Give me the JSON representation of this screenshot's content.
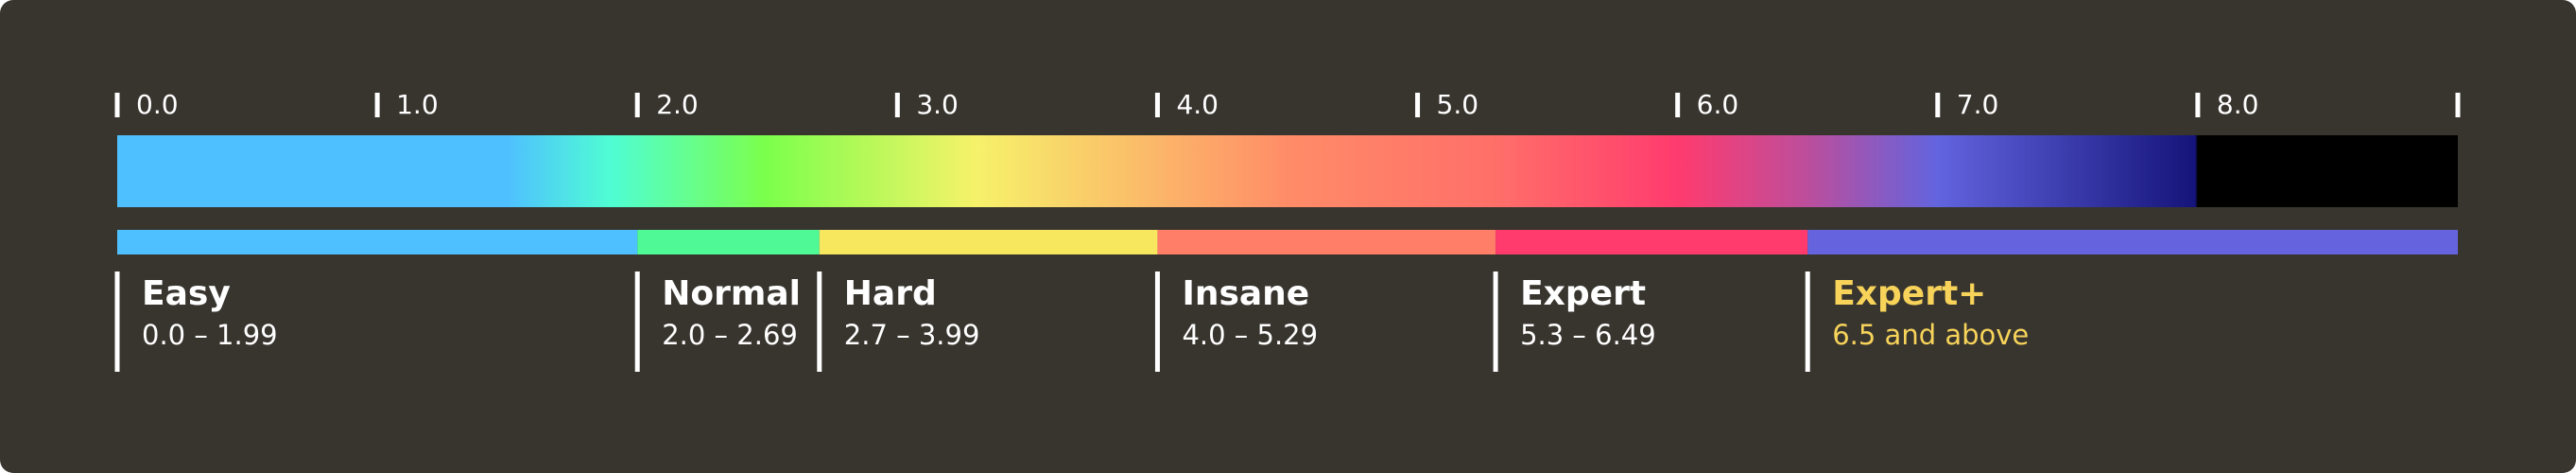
{
  "chart_data": {
    "type": "bar",
    "title": "",
    "xlabel": "",
    "ylabel": "",
    "xlim": [
      0,
      9
    ],
    "tick_values": [
      0,
      1,
      2,
      3,
      4,
      5,
      6,
      7,
      8,
      9
    ],
    "tick_labels": [
      "0.0",
      "1.0",
      "2.0",
      "3.0",
      "4.0",
      "5.0",
      "6.0",
      "7.0",
      "8.0",
      ""
    ],
    "gradient_stops": [
      {
        "value": 0.0,
        "color": "#4fc0ff"
      },
      {
        "value": 1.5,
        "color": "#4fc0ff"
      },
      {
        "value": 1.9,
        "color": "#4ffdd3"
      },
      {
        "value": 2.5,
        "color": "#7cff4a"
      },
      {
        "value": 3.3,
        "color": "#f6f26a"
      },
      {
        "value": 4.5,
        "color": "#ff8c68"
      },
      {
        "value": 5.3,
        "color": "#ff6f69"
      },
      {
        "value": 6.0,
        "color": "#ff3b6e"
      },
      {
        "value": 6.5,
        "color": "#bc4e9c"
      },
      {
        "value": 7.0,
        "color": "#6264df"
      },
      {
        "value": 7.99,
        "color": "#15147a"
      },
      {
        "value": 8.0,
        "color": "#000000"
      },
      {
        "value": 9.0,
        "color": "#000000"
      }
    ],
    "categories": [
      {
        "name": "Easy",
        "range": "0.0 – 1.99",
        "start": 0.0,
        "end": 2.0,
        "color": "#4fc0ff",
        "text_color": "#ffffff"
      },
      {
        "name": "Normal",
        "range": "2.0 – 2.69",
        "start": 2.0,
        "end": 2.7,
        "color": "#4ffa96",
        "text_color": "#ffffff"
      },
      {
        "name": "Hard",
        "range": "2.7 – 3.99",
        "start": 2.7,
        "end": 4.0,
        "color": "#f6e75f",
        "text_color": "#ffffff"
      },
      {
        "name": "Insane",
        "range": "4.0 – 5.29",
        "start": 4.0,
        "end": 5.3,
        "color": "#ff7e68",
        "text_color": "#ffffff"
      },
      {
        "name": "Expert",
        "range": "5.3 – 6.49",
        "start": 5.3,
        "end": 6.5,
        "color": "#ff3b6d",
        "text_color": "#ffffff"
      },
      {
        "name": "Expert+",
        "range": "6.5 and above",
        "start": 6.5,
        "end": 9.0,
        "color": "#6563de",
        "text_color": "#f7d35a"
      }
    ]
  }
}
